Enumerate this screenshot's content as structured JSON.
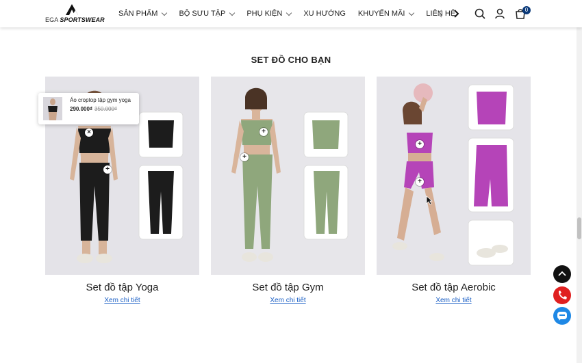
{
  "header": {
    "logo_brand_light": "EGA",
    "logo_brand_bold": "SPORTSWEAR",
    "nav": [
      {
        "label": "SẢN PHẨM",
        "has_dropdown": true
      },
      {
        "label": "BỘ SƯU TẬP",
        "has_dropdown": true
      },
      {
        "label": "PHỤ KIỆN",
        "has_dropdown": true
      },
      {
        "label": "XU HƯỚNG",
        "has_dropdown": false
      },
      {
        "label": "KHUYẾN MÃI",
        "has_dropdown": true
      },
      {
        "label": "LIÊN HỆ",
        "has_dropdown": false
      }
    ],
    "cart_count": "0",
    "icons": [
      "search-icon",
      "user-icon",
      "cart-icon",
      "chevron-left-icon",
      "chevron-right-icon"
    ]
  },
  "section": {
    "title": "SET ĐỒ CHO BẠN"
  },
  "cards": [
    {
      "title": "Set đồ tập Yoga",
      "link": "Xem chi tiết",
      "outfit_color": "#1c1c1c"
    },
    {
      "title": "Set đồ tập Gym",
      "link": "Xem chi tiết",
      "outfit_color": "#8fa77c"
    },
    {
      "title": "Set đồ tập Aerobic",
      "link": "Xem chi tiết",
      "outfit_color": "#b544b8"
    }
  ],
  "popup": {
    "name": "Áo croptop tập gym yoga",
    "price": "290.000₫",
    "old_price": "350.000₫"
  },
  "floating": [
    "back-to-top-icon",
    "phone-icon",
    "zalo-icon"
  ]
}
